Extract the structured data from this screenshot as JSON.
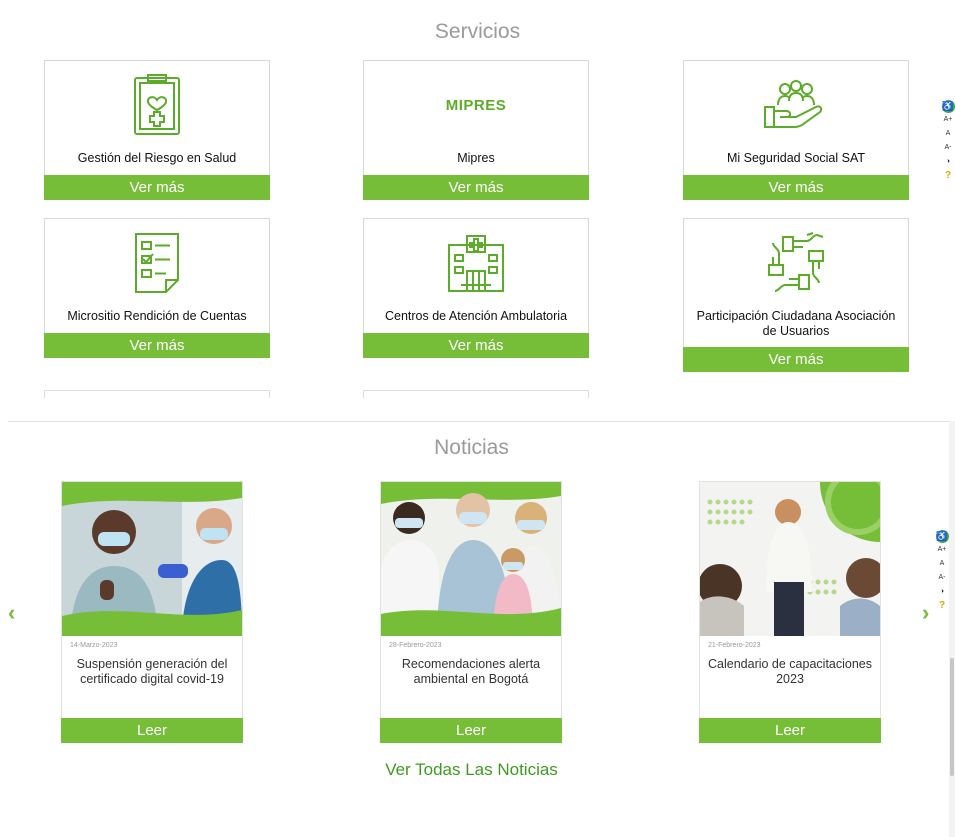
{
  "services": {
    "title": "Servicios",
    "button_label": "Ver más",
    "items": [
      {
        "label": "Gestión del Riesgo en Salud",
        "icon": "clipboard-heart-icon"
      },
      {
        "label": "Mipres",
        "icon": "mipres-logo",
        "logo_text": "MIPRES"
      },
      {
        "label": "Mi Seguridad Social SAT",
        "icon": "hand-people-icon"
      },
      {
        "label": "Micrositio Rendición de Cuentas",
        "icon": "checklist-icon"
      },
      {
        "label": "Centros de Atención Ambulatoria",
        "icon": "hospital-icon"
      },
      {
        "label": "Participación Ciudadana Asociación de Usuarios",
        "icon": "hands-circle-icon"
      }
    ]
  },
  "news": {
    "title": "Noticias",
    "button_label": "Leer",
    "all_link": "Ver Todas Las Noticias",
    "items": [
      {
        "date": "14-Marzo-2023",
        "title": "Suspensión generación del certificado digital covid-19",
        "image": "vaccination-photo"
      },
      {
        "date": "28-Febrero-2023",
        "title": "Recomendaciones alerta ambiental en Bogotá",
        "image": "family-masks-photo"
      },
      {
        "date": "21-Febrero-2023",
        "title": "Calendario de capacitaciones 2023",
        "image": "training-photo"
      }
    ]
  },
  "accessibility": {
    "font_increase": "A+",
    "font_reset": "A",
    "font_decrease": "A-",
    "contrast": "◑",
    "help": "?"
  },
  "colors": {
    "accent": "#76bd38",
    "icon_green": "#5cab2a",
    "link_green": "#3f9a22",
    "title_gray": "#9a9a9a"
  }
}
